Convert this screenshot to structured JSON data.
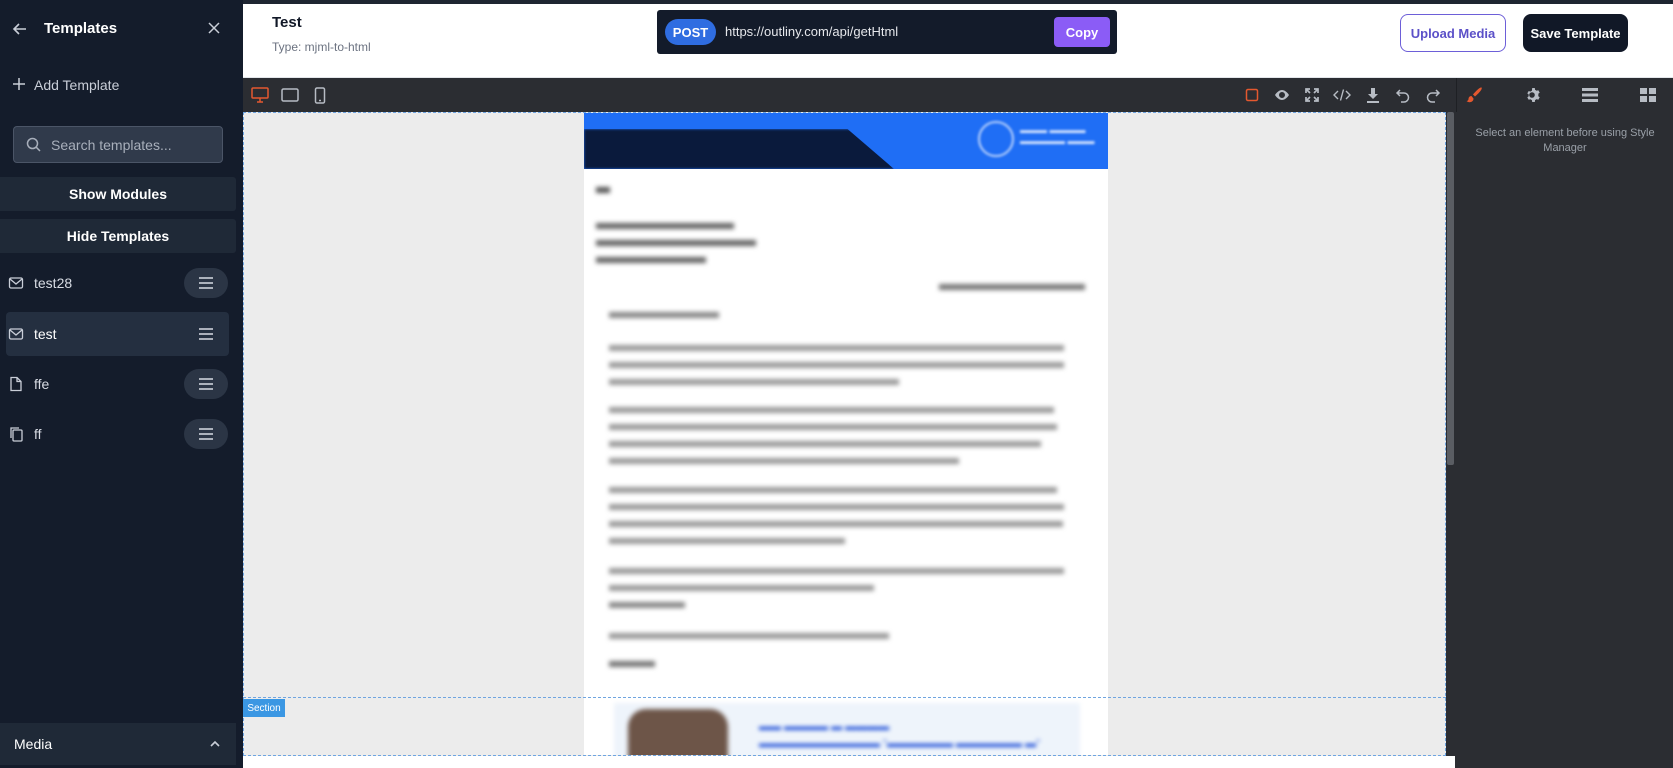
{
  "sidebar": {
    "title": "Templates",
    "add_template_label": "Add Template",
    "search_placeholder": "Search templates...",
    "show_modules_label": "Show Modules",
    "hide_templates_label": "Hide Templates",
    "templates": [
      {
        "label": "test28",
        "icon": "mail-icon"
      },
      {
        "label": "test",
        "icon": "mail-icon",
        "active": true
      },
      {
        "label": "ffe",
        "icon": "file-icon"
      },
      {
        "label": "ff",
        "icon": "copy-icon"
      }
    ],
    "media_label": "Media"
  },
  "header": {
    "title": "Test",
    "type_text": "Type: mjml-to-html",
    "method": "POST",
    "api_url": "https://outliny.com/api/getHtml",
    "copy_label": "Copy",
    "upload_media_label": "Upload Media",
    "save_template_label": "Save Template"
  },
  "toolbar": {
    "device_icons": [
      "desktop-icon",
      "tablet-icon",
      "mobile-icon"
    ],
    "active_device": "desktop",
    "action_icons": [
      "component-outline-icon",
      "eye-preview-icon",
      "fullscreen-icon",
      "code-icon",
      "download-icon",
      "undo-icon",
      "redo-icon"
    ],
    "panel_icons": [
      "style-brush-icon",
      "settings-gear-icon",
      "layers-icon",
      "blocks-grid-icon"
    ],
    "accent_color": "#e4582f"
  },
  "canvas": {
    "section_label": "Section"
  },
  "right_panel": {
    "message": "Select an element before using Style Manager"
  },
  "colors": {
    "sidebar_bg": "#141c2b",
    "post_badge": "#2f6de1",
    "copy_button": "#8b5cf6",
    "upload_border": "#6d5fd8",
    "save_button": "#111827",
    "section_badge": "#3b97e3"
  }
}
